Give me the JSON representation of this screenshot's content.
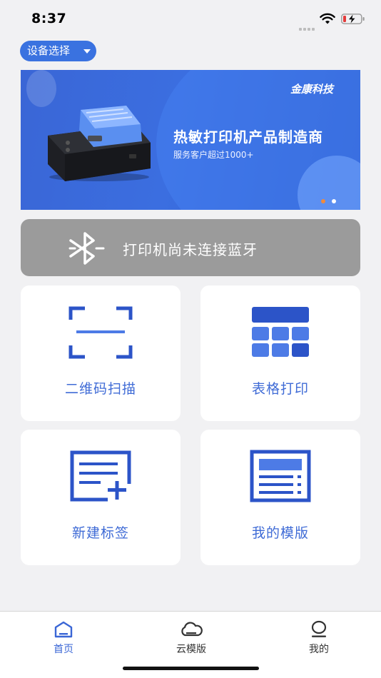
{
  "status_bar": {
    "time": "8:37"
  },
  "device_select": {
    "label": "设备选择",
    "icon": "caret-down-icon"
  },
  "banner": {
    "brand": "金康科技",
    "headline": "热敏打印机产品制造商",
    "subline": "服务客户超过1000+",
    "active_dot_color": "#f08a3c",
    "inactive_dot_color": "#ffffff",
    "slide_count": 2,
    "active_slide": 1
  },
  "bluetooth": {
    "status_text": "打印机尚未连接蓝牙",
    "icon": "bluetooth-icon",
    "bar_color": "#9b9b9b"
  },
  "tiles": [
    {
      "label": "二维码扫描",
      "icon": "scan-icon"
    },
    {
      "label": "表格打印",
      "icon": "table-grid-icon"
    },
    {
      "label": "新建标签",
      "icon": "new-label-icon"
    },
    {
      "label": "我的模版",
      "icon": "template-icon"
    }
  ],
  "tab_bar": {
    "items": [
      {
        "label": "首页",
        "icon": "home-icon",
        "active": true
      },
      {
        "label": "云模版",
        "icon": "cloud-icon",
        "active": false
      },
      {
        "label": "我的",
        "icon": "user-icon",
        "active": false
      }
    ],
    "active_color": "#3a66d6",
    "inactive_color": "#333333"
  },
  "colors": {
    "accent": "#3a66d6",
    "tile_label": "#3f6bd6",
    "page_background": "#f1f1f3"
  }
}
